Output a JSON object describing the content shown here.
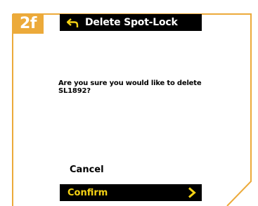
{
  "step": {
    "label": "2f"
  },
  "header": {
    "back_icon": "back-arrow-icon",
    "title": "Delete Spot-Lock"
  },
  "dialog": {
    "message": "Are you sure you would like to delete SL1892?"
  },
  "actions": {
    "cancel_label": "Cancel",
    "confirm_label": "Confirm",
    "confirm_icon": "chevron-right-icon"
  },
  "colors": {
    "accent": "#ecaa3a",
    "confirm_text": "#f5d214",
    "bar_background": "#000000"
  }
}
